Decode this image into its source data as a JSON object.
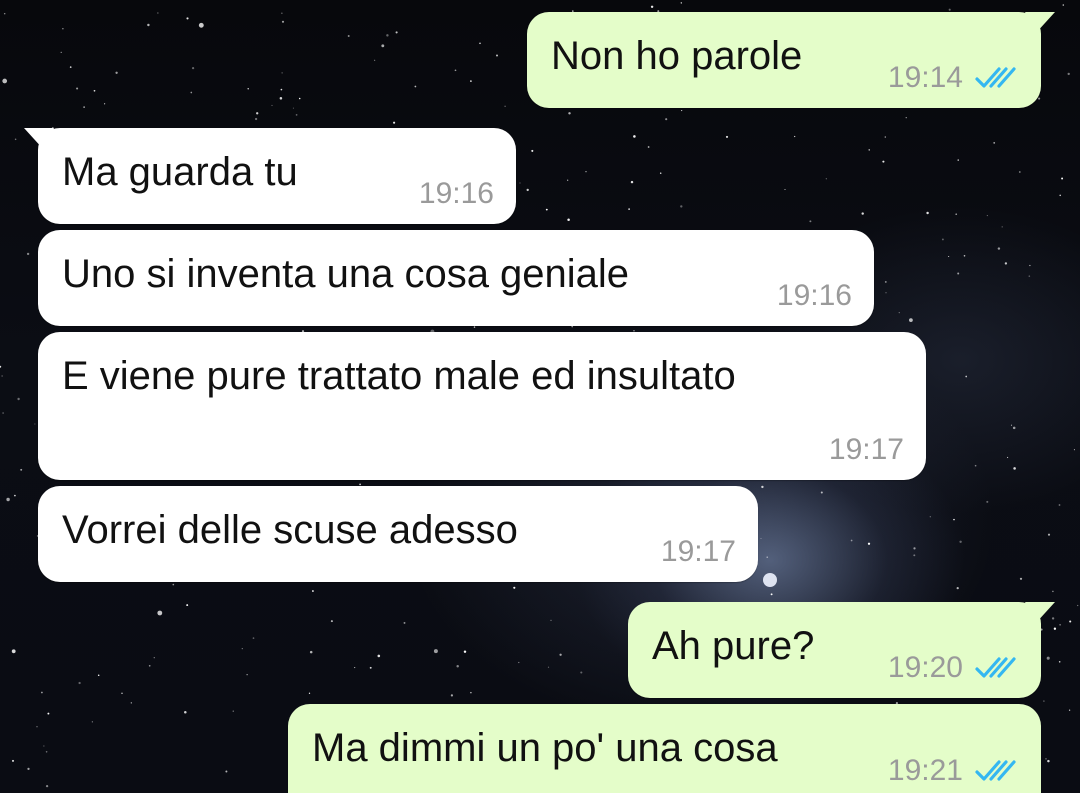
{
  "chat": {
    "messages": [
      {
        "direction": "outgoing",
        "text": "Non ho parole",
        "time": "19:14",
        "status": "read"
      },
      {
        "direction": "incoming",
        "text": "Ma guarda tu",
        "time": "19:16"
      },
      {
        "direction": "incoming",
        "text": "Uno si inventa una cosa geniale",
        "time": "19:16"
      },
      {
        "direction": "incoming",
        "text": "E viene pure trattato male ed insultato",
        "time": "19:17"
      },
      {
        "direction": "incoming",
        "text": "Vorrei delle scuse adesso",
        "time": "19:17"
      },
      {
        "direction": "outgoing",
        "text": "Ah pure?",
        "time": "19:20",
        "status": "read"
      },
      {
        "direction": "outgoing",
        "text": "Ma dimmi un po' una cosa",
        "time": "19:21",
        "status": "read"
      }
    ]
  },
  "colors": {
    "incoming_bubble": "#ffffff",
    "outgoing_bubble": "#e4fdc9",
    "read_ticks": "#34b7f1",
    "timestamp": "#9a9a9a"
  },
  "icons": {
    "read_receipt": "double-check-icon"
  }
}
